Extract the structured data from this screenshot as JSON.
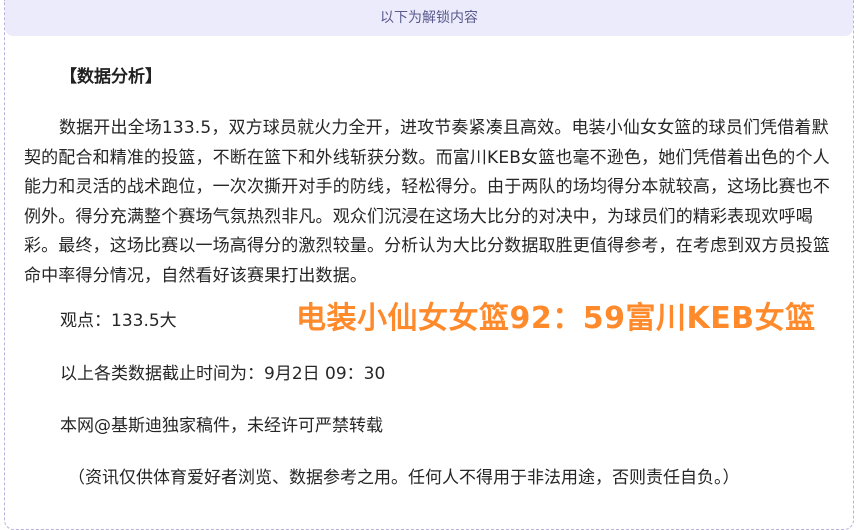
{
  "unlock_banner": "以下为解锁内容",
  "heading": "【数据分析】",
  "analysis_paragraph": "数据开出全场133.5，双方球员就火力全开，进攻节奏紧凑且高效。电装小仙女女篮的球员们凭借着默契的配合和精准的投篮，不断在篮下和外线斩获分数。而富川KEB女篮也毫不逊色，她们凭借着出色的个人能力和灵活的战术跑位，一次次撕开对手的防线，轻松得分。由于两队的场均得分本就较高，这场比赛也不例外。得分充满整个赛场气氛热烈非凡。观众们沉浸在这场大比分的对决中，为球员们的精彩表现欢呼喝彩。最终，这场比赛以一场高得分的激烈较量。分析认为大比分数据取胜更值得参考，在考虑到双方员投篮命中率得分情况，自然看好该赛果打出数据。",
  "opinion": "观点：133.5大",
  "score_overlay": "电装小仙女女篮92：59富川KEB女篮",
  "data_cutoff": "以上各类数据截止时间为：9月2日 09：30",
  "copyright": "本网@基斯迪独家稿件，未经许可严禁转载",
  "disclaimer": "（资讯仅供体育爱好者浏览、数据参考之用。任何人不得用于非法用途，否则责任自负。）",
  "colors": {
    "banner_bg": "#ecebfb",
    "banner_text": "#5b5b8f",
    "overlay_text": "#ff8a2b",
    "frame_border": "#b9b2dc"
  }
}
